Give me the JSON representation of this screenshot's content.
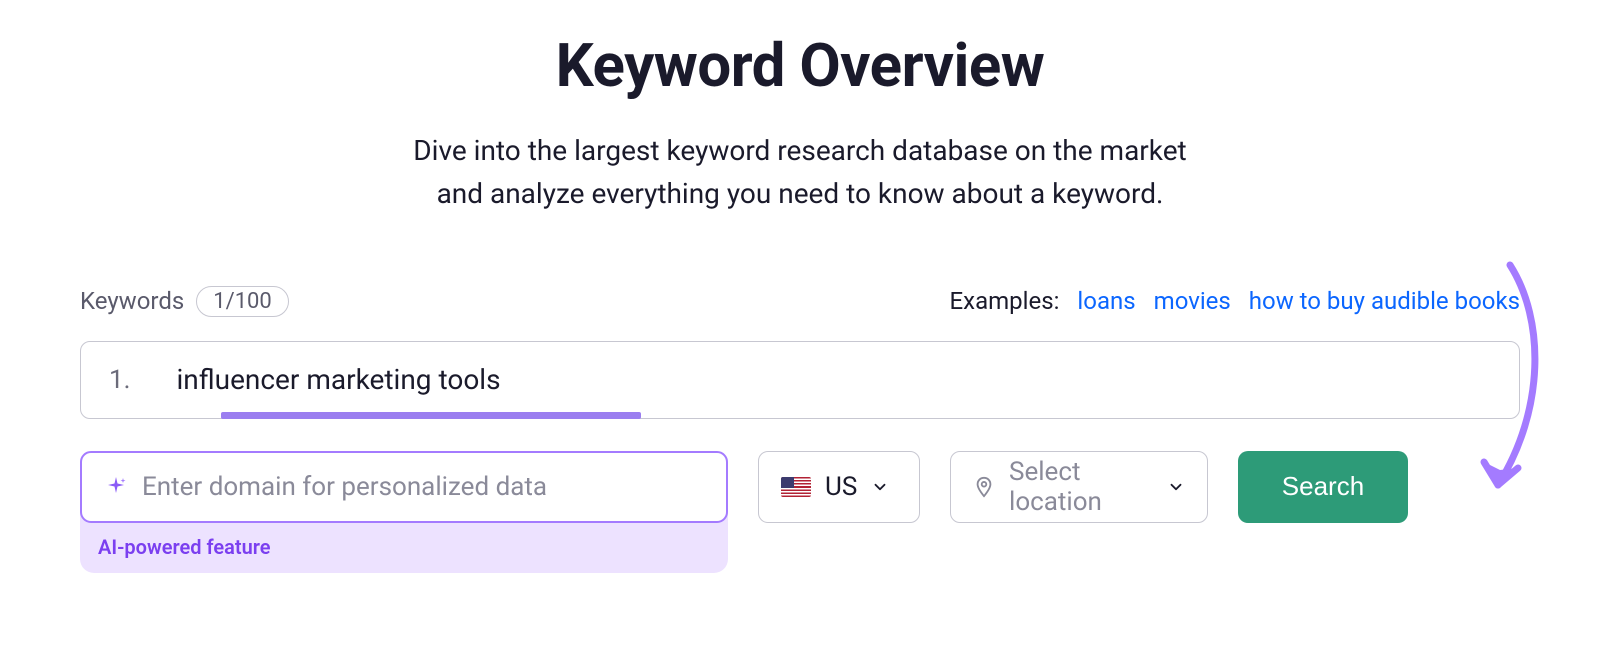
{
  "header": {
    "title": "Keyword Overview",
    "subtitle_line1": "Dive into the largest keyword research database on the market",
    "subtitle_line2": "and analyze everything you need to know about a keyword."
  },
  "keywords_bar": {
    "label": "Keywords",
    "count": "1/100",
    "examples_label": "Examples:",
    "examples": [
      "loans",
      "movies",
      "how to buy audible books"
    ]
  },
  "keyword_input": {
    "index": "1.",
    "value": "influencer marketing tools"
  },
  "domain": {
    "placeholder": "Enter domain for personalized data",
    "ai_label": "AI-powered feature"
  },
  "country": {
    "code": "US"
  },
  "location": {
    "placeholder": "Select location"
  },
  "search_button": "Search"
}
